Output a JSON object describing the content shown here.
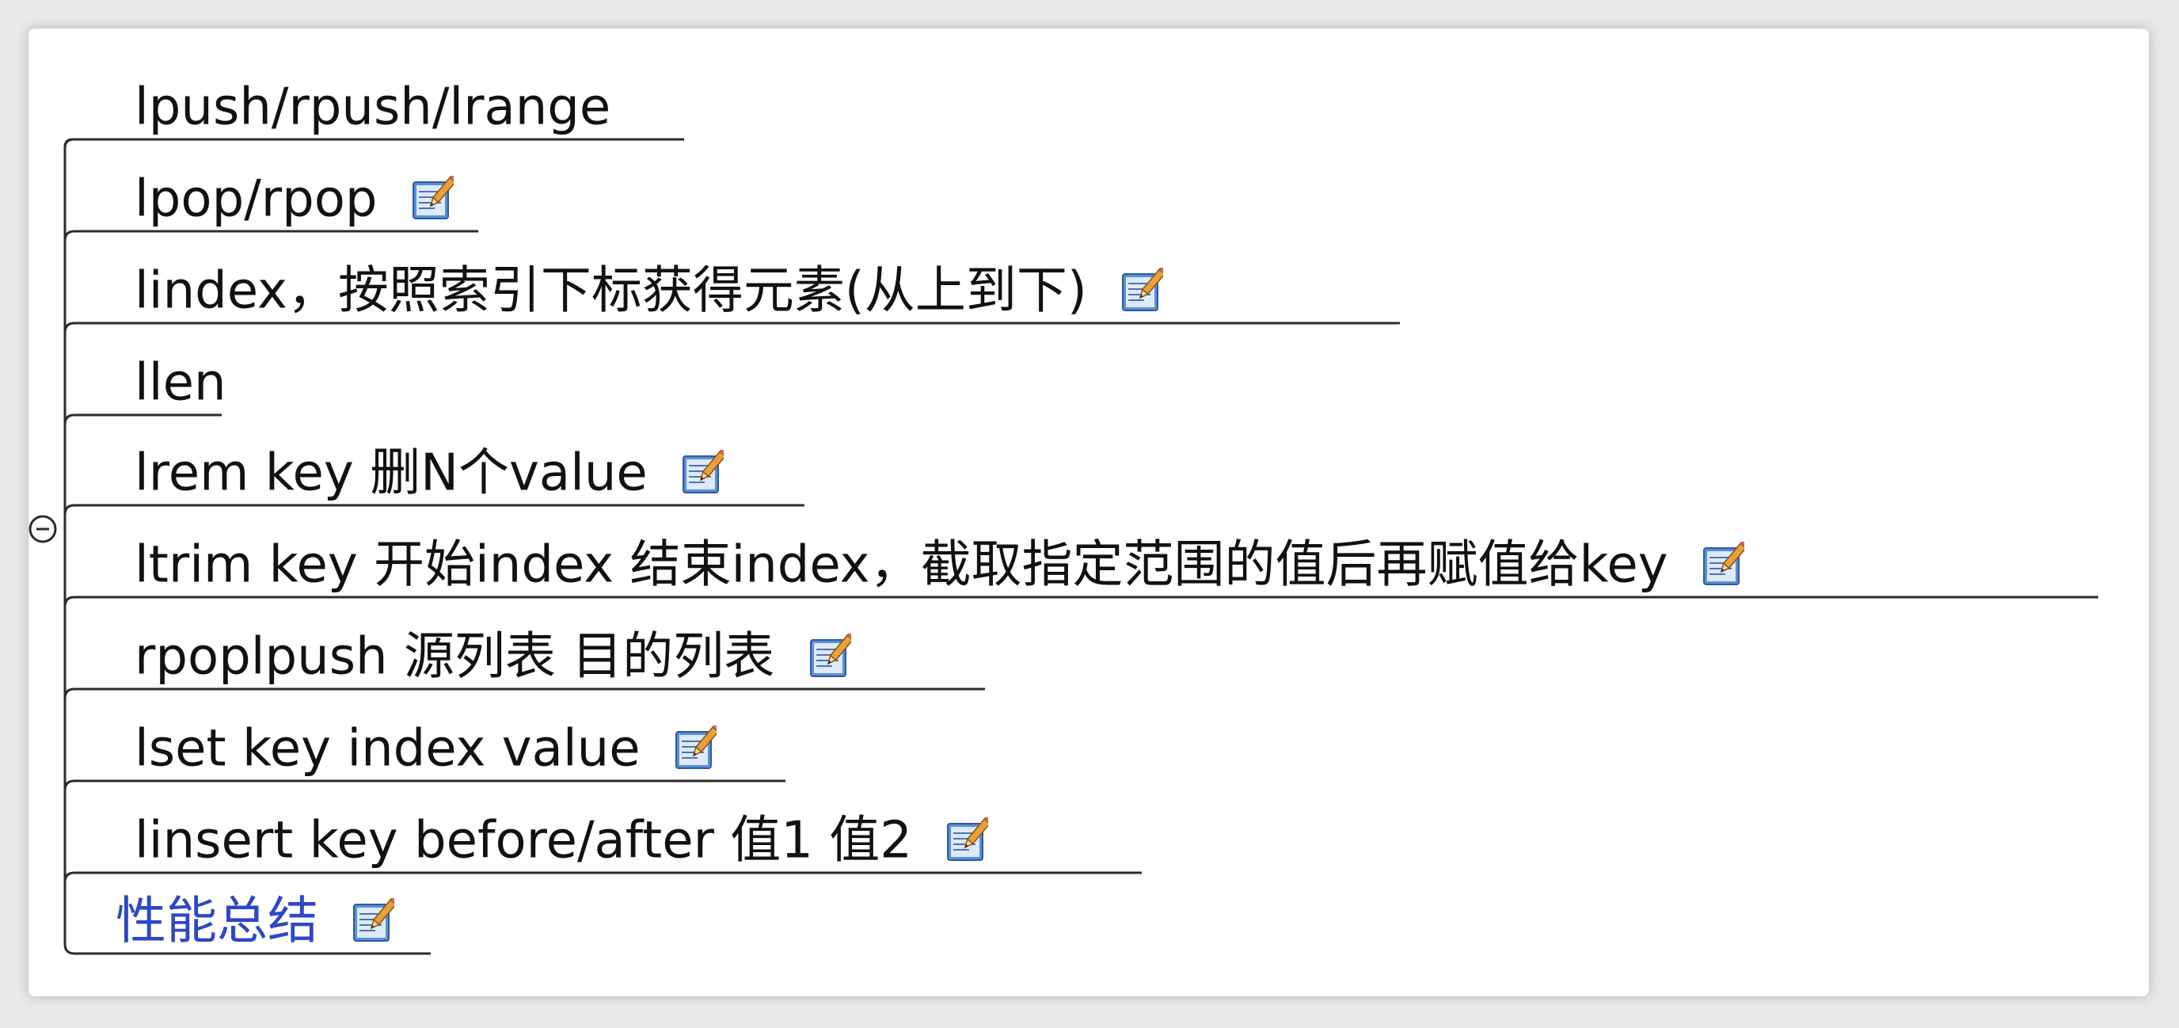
{
  "mindmap": {
    "items": [
      {
        "label": "lpush/rpush/lrange",
        "note": false,
        "style": "normal"
      },
      {
        "label": "lpop/rpop",
        "note": true,
        "style": "normal"
      },
      {
        "label": "lindex，按照索引下标获得元素(从上到下)",
        "note": true,
        "style": "normal"
      },
      {
        "label": "llen",
        "note": false,
        "style": "normal"
      },
      {
        "label": "lrem key 删N个value",
        "note": true,
        "style": "normal"
      },
      {
        "label": "ltrim key 开始index 结束index，截取指定范围的值后再赋值给key",
        "note": true,
        "style": "normal"
      },
      {
        "label": "rpoplpush 源列表 目的列表",
        "note": true,
        "style": "normal"
      },
      {
        "label": "lset key index value",
        "note": true,
        "style": "normal"
      },
      {
        "label": "linsert key  before/after 值1 值2",
        "note": true,
        "style": "normal"
      },
      {
        "label": "性能总结",
        "note": true,
        "style": "link"
      }
    ]
  },
  "colors": {
    "text": "#111111",
    "link_text": "#2e47c6",
    "connector": "#2b2b2b",
    "background": "#ffffff"
  },
  "icons": {
    "note": "note-pencil-icon",
    "collapse": "collapse-minus-icon"
  }
}
